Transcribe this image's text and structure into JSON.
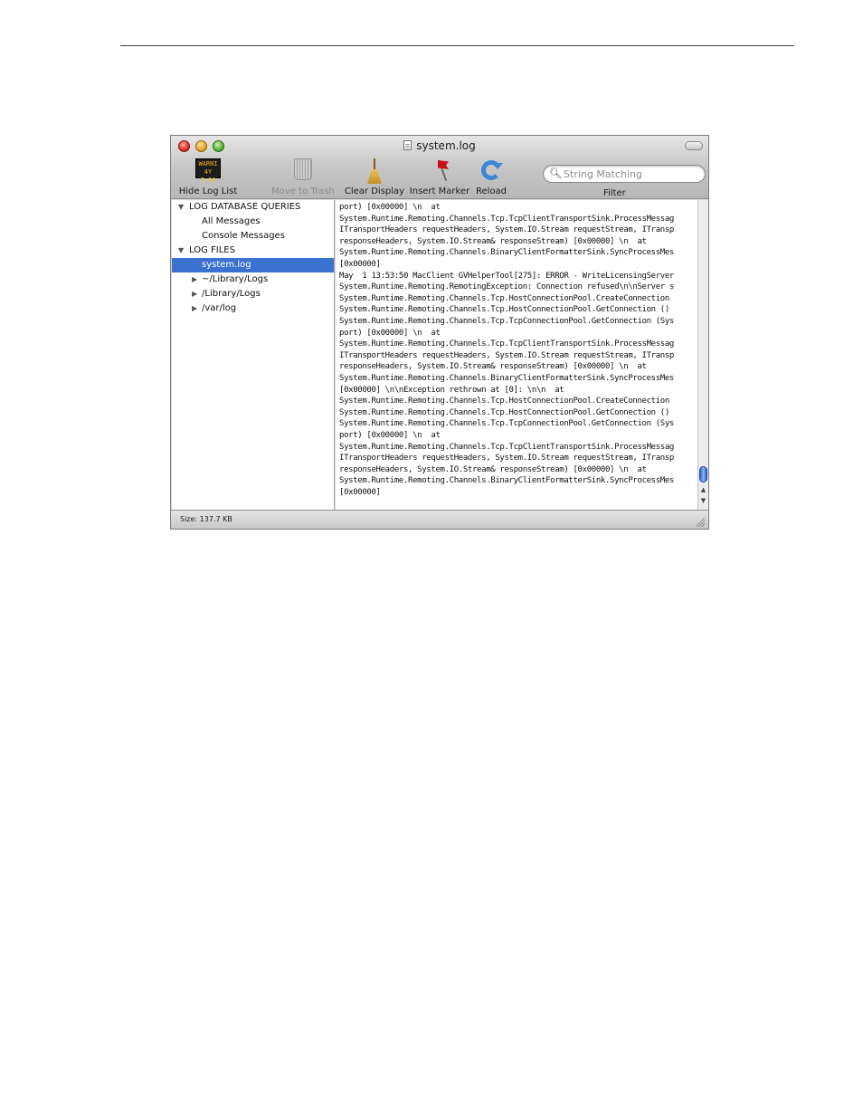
{
  "window": {
    "title": "system.log"
  },
  "toolbar": {
    "hide_log_list": "Hide Log List",
    "warn_icon_text": [
      "WARNI",
      "4Y 7:36"
    ],
    "move_to_trash": "Move to Trash",
    "clear_display": "Clear Display",
    "insert_marker": "Insert Marker",
    "reload": "Reload",
    "search_placeholder": "String Matching",
    "filter_label": "Filter"
  },
  "sidebar": {
    "section_queries": "LOG DATABASE QUERIES",
    "all_messages": "All Messages",
    "console_messages": "Console Messages",
    "section_files": "LOG FILES",
    "system_log": "system.log",
    "user_library_logs": "~/Library/Logs",
    "library_logs": "/Library/Logs",
    "var_log": "/var/log"
  },
  "log_lines": [
    "port) [0x00000] \\n  at",
    "System.Runtime.Remoting.Channels.Tcp.TcpClientTransportSink.ProcessMessag",
    "ITransportHeaders requestHeaders, System.IO.Stream requestStream, ITransp",
    "responseHeaders, System.IO.Stream& responseStream) [0x00000] \\n  at",
    "System.Runtime.Remoting.Channels.BinaryClientFormatterSink.SyncProcessMes",
    "[0x00000]",
    "May  1 13:53:50 MacClient GVHelperTool[275]: ERROR - WriteLicensingServer",
    "System.Runtime.Remoting.RemotingException: Connection refused\\n\\nServer s",
    "System.Runtime.Remoting.Channels.Tcp.HostConnectionPool.CreateConnection",
    "System.Runtime.Remoting.Channels.Tcp.HostConnectionPool.GetConnection ()",
    "System.Runtime.Remoting.Channels.Tcp.TcpConnectionPool.GetConnection (Sys",
    "port) [0x00000] \\n  at",
    "System.Runtime.Remoting.Channels.Tcp.TcpClientTransportSink.ProcessMessag",
    "ITransportHeaders requestHeaders, System.IO.Stream requestStream, ITransp",
    "responseHeaders, System.IO.Stream& responseStream) [0x00000] \\n  at",
    "System.Runtime.Remoting.Channels.BinaryClientFormatterSink.SyncProcessMes",
    "[0x00000] \\n\\nException rethrown at [0]: \\n\\n  at",
    "System.Runtime.Remoting.Channels.Tcp.HostConnectionPool.CreateConnection",
    "System.Runtime.Remoting.Channels.Tcp.HostConnectionPool.GetConnection ()",
    "System.Runtime.Remoting.Channels.Tcp.TcpConnectionPool.GetConnection (Sys",
    "port) [0x00000] \\n  at",
    "System.Runtime.Remoting.Channels.Tcp.TcpClientTransportSink.ProcessMessag",
    "ITransportHeaders requestHeaders, System.IO.Stream requestStream, ITransp",
    "responseHeaders, System.IO.Stream& responseStream) [0x00000] \\n  at",
    "System.Runtime.Remoting.Channels.BinaryClientFormatterSink.SyncProcessMes",
    "[0x00000]"
  ],
  "status": {
    "size": "Size: 137.7 KB"
  },
  "colors": {
    "selection": "#3b72d2",
    "warn_text": "#f2b31f",
    "flag": "#c8131b",
    "reload": "#3d86d6"
  }
}
